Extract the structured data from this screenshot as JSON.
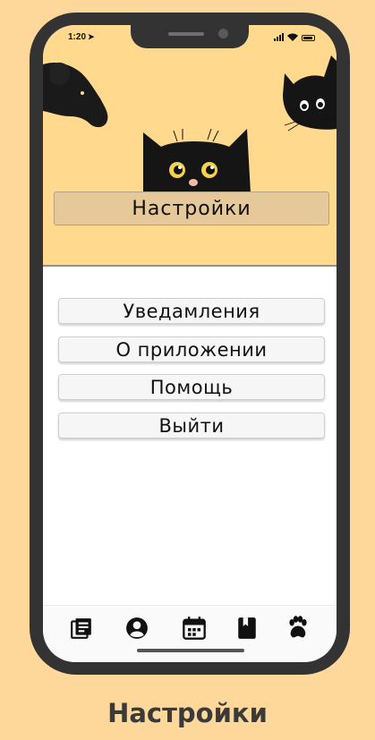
{
  "status_bar": {
    "time": "1:20",
    "location_arrow": "location-arrow-icon"
  },
  "header": {
    "title": "Настройки"
  },
  "menu": {
    "items": [
      {
        "label": "Уведамления"
      },
      {
        "label": "О приложении"
      },
      {
        "label": "Помощь"
      },
      {
        "label": "Выйти"
      }
    ]
  },
  "tabbar": {
    "items": [
      {
        "icon": "news-icon"
      },
      {
        "icon": "profile-icon"
      },
      {
        "icon": "calendar-icon"
      },
      {
        "icon": "book-icon"
      },
      {
        "icon": "paw-icon"
      }
    ]
  },
  "caption": "Настройки",
  "colors": {
    "background": "#fdd89a",
    "header_bg": "#fed98e",
    "title_box": "#e6c99a",
    "phone_frame": "#333333"
  }
}
